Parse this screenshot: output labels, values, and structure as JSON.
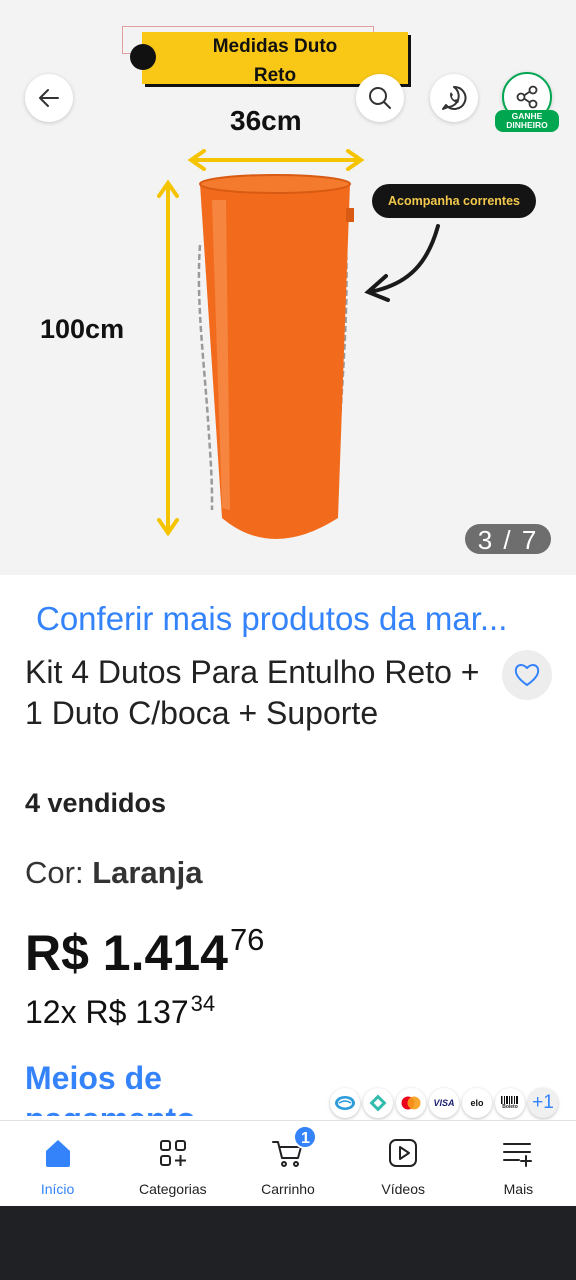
{
  "gallery": {
    "banner_line1": "Medidas Duto",
    "banner_line2": "Reto",
    "width_label": "36cm",
    "height_label": "100cm",
    "callout": "Acompanha correntes",
    "counter": "3 / 7",
    "earn_badge_line1": "GANHE",
    "earn_badge_line2": "DINHEIRO",
    "duct_color": "#f26b1d",
    "arrow_color": "#f5c400"
  },
  "product": {
    "store_link": "Conferir mais produtos da mar...",
    "title": "Kit 4 Dutos Para Entulho Reto + 1 Duto C/boca + Suporte",
    "sold": "4 vendidos",
    "color_label": "Cor: ",
    "color_value": "Laranja",
    "price_main": "R$ 1.414",
    "price_cents": "76",
    "installment_prefix": "12x",
    "installment_value": "R$ 137",
    "installment_cents": "34",
    "payments_link": "Meios de pagamento",
    "payment_icons": [
      "mercado-pago",
      "pix",
      "mastercard",
      "VISA",
      "elo",
      "Boleto"
    ],
    "payment_more": "+1"
  },
  "nav": {
    "items": [
      {
        "label": "Início",
        "icon": "home-icon",
        "active": true
      },
      {
        "label": "Categorias",
        "icon": "categories-icon"
      },
      {
        "label": "Carrinho",
        "icon": "cart-icon"
      },
      {
        "label": "Vídeos",
        "icon": "video-icon"
      },
      {
        "label": "Mais",
        "icon": "menu-plus-icon"
      }
    ],
    "cart_count": "1"
  },
  "colors": {
    "accent": "#3483fa",
    "share_green": "#00a650"
  }
}
